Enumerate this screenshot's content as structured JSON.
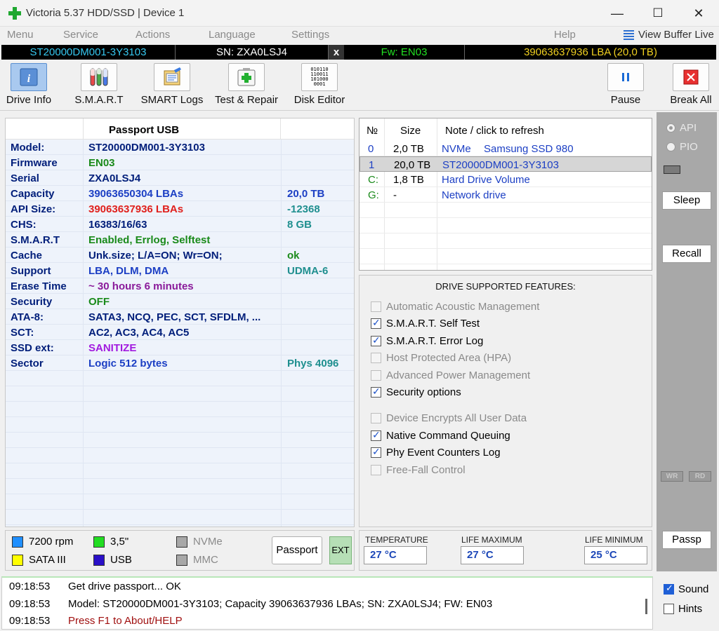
{
  "window": {
    "title": "Victoria 5.37 HDD/SSD | Device 1",
    "minimize": "—",
    "maximize": "☐",
    "close": "✕"
  },
  "menu": {
    "items": [
      "Menu",
      "Service",
      "Actions",
      "Language",
      "Settings",
      "Help"
    ],
    "view_buffer": "View Buffer Live"
  },
  "device_bar": {
    "model": "ST20000DM001-3Y3103",
    "serial": "SN: ZXA0LSJ4",
    "close": "x",
    "firmware": "Fw: EN03",
    "lba": "39063637936 LBA (20,0 TB)"
  },
  "toolbar": {
    "drive_info": "Drive Info",
    "smart": "S.M.A.R.T",
    "smart_logs": "SMART Logs",
    "test_repair": "Test & Repair",
    "disk_editor": "Disk Editor",
    "pause": "Pause",
    "break_all": "Break All",
    "disk_editor_glyph": [
      "010110",
      "110011",
      "101000",
      "0001"
    ]
  },
  "passport": {
    "header": "Passport USB",
    "rows": [
      {
        "key": "Model:",
        "value": "ST20000DM001-3Y3103",
        "extra": "",
        "color": "#001e7a",
        "extra_color": ""
      },
      {
        "key": "Firmware",
        "value": "EN03",
        "extra": "",
        "color": "#1a8a1a",
        "extra_color": ""
      },
      {
        "key": "Serial",
        "value": "ZXA0LSJ4",
        "extra": "",
        "color": "#001e7a",
        "extra_color": ""
      },
      {
        "key": "Capacity",
        "value": "39063650304 LBAs",
        "extra": "20,0 TB",
        "color": "#1c3fc4",
        "extra_color": "#1c3fc4"
      },
      {
        "key": "API Size:",
        "value": "39063637936 LBAs",
        "extra": "-12368",
        "color": "#e0201c",
        "extra_color": "#1f8f8f"
      },
      {
        "key": "CHS:",
        "value": "16383/16/63",
        "extra": "8 GB",
        "color": "#001e7a",
        "extra_color": "#1f8f8f"
      },
      {
        "key": "S.M.A.R.T",
        "value": "Enabled, Errlog, Selftest",
        "extra": "",
        "color": "#1a8a1a",
        "extra_color": ""
      },
      {
        "key": "Cache",
        "value": "Unk.size; L/A=ON; Wr=ON;",
        "extra": "ok",
        "color": "#001e7a",
        "extra_color": "#1a8a1a"
      },
      {
        "key": "Support",
        "value": "LBA, DLM, DMA",
        "extra": "UDMA-6",
        "color": "#1c3fc4",
        "extra_color": "#1f8f8f"
      },
      {
        "key": "Erase Time",
        "value": "~ 30 hours 6 minutes",
        "extra": "",
        "color": "#8a1a9a",
        "extra_color": ""
      },
      {
        "key": "Security",
        "value": "OFF",
        "extra": "",
        "color": "#1a8a1a",
        "extra_color": ""
      },
      {
        "key": "ATA-8:",
        "value": "SATA3, NCQ, PEC, SCT, SFDLM, ...",
        "extra": "",
        "color": "#001e7a",
        "extra_color": ""
      },
      {
        "key": "SCT:",
        "value": "AC2, AC3, AC4, AC5",
        "extra": "",
        "color": "#001e7a",
        "extra_color": ""
      },
      {
        "key": "SSD ext:",
        "value": "SANITIZE",
        "extra": "",
        "color": "#a21adf",
        "extra_color": ""
      },
      {
        "key": "Sector",
        "value": "Logic 512 bytes",
        "extra": "Phys 4096",
        "color": "#1c3fc4",
        "extra_color": "#1f8f8f"
      }
    ]
  },
  "device_list": {
    "headers": [
      "№",
      "Size",
      "Note / click to refresh"
    ],
    "rows": [
      {
        "no": "0",
        "size": "2,0 TB",
        "note": "NVMe",
        "note2": "Samsung SSD 980",
        "no_color": "#1c3fc4",
        "note_color": "#1c3fc4"
      },
      {
        "no": "1",
        "size": "20,0 TB",
        "note": "ST20000DM001-3Y3103",
        "note2": "",
        "no_color": "#1c3fc4",
        "note_color": "#1c3fc4"
      },
      {
        "no": "C:",
        "size": "1,8 TB",
        "note": "Hard Drive Volume",
        "note2": "",
        "no_color": "#1a8a1a",
        "note_color": "#1c3fc4"
      },
      {
        "no": "G:",
        "size": "-",
        "note": "Network drive",
        "note2": "",
        "no_color": "#1a8a1a",
        "note_color": "#1c3fc4"
      }
    ]
  },
  "features": {
    "title": "DRIVE SUPPORTED FEATURES:",
    "items": [
      {
        "label": "Automatic Acoustic Management",
        "checked": false,
        "enabled": false
      },
      {
        "label": "S.M.A.R.T. Self Test",
        "checked": true,
        "enabled": true
      },
      {
        "label": "S.M.A.R.T. Error Log",
        "checked": true,
        "enabled": true
      },
      {
        "label": "Host Protected Area (HPA)",
        "checked": false,
        "enabled": false
      },
      {
        "label": "Advanced Power Management",
        "checked": false,
        "enabled": false
      },
      {
        "label": "Security options",
        "checked": true,
        "enabled": true
      },
      {
        "label": "Device Encrypts All User Data",
        "checked": false,
        "enabled": false
      },
      {
        "label": "Native Command Queuing",
        "checked": true,
        "enabled": true
      },
      {
        "label": "Phy Event Counters Log",
        "checked": true,
        "enabled": true
      },
      {
        "label": "Free-Fall Control",
        "checked": false,
        "enabled": false
      }
    ]
  },
  "sidebar": {
    "api": "API",
    "pio": "PIO",
    "sleep": "Sleep",
    "recall": "Recall",
    "wr": "WR",
    "rd": "RD",
    "passp": "Passp"
  },
  "status": {
    "rpm": "7200 rpm",
    "form": "3,5\"",
    "nvme": "NVMe",
    "sata": "SATA III",
    "usb": "USB",
    "mmc": "MMC",
    "passport_btn": "Passport",
    "ext_btn": "EXT",
    "colors": {
      "rpm": "#1f8fff",
      "form": "#22dd22",
      "nvme": "#a8a8a8",
      "sata": "#ffff00",
      "usb": "#2a10c8",
      "mmc": "#a8a8a8"
    }
  },
  "temps": {
    "temperature_label": "TEMPERATURE",
    "temperature": "27 °C",
    "life_max_label": "LIFE MAXIMUM",
    "life_max": "27 °C",
    "life_min_label": "LIFE MINIMUM",
    "life_min": "25 °C"
  },
  "log": [
    {
      "time": "09:18:53",
      "msg": "Get drive passport... OK",
      "color": "#000000"
    },
    {
      "time": "09:18:53",
      "msg": "Model: ST20000DM001-3Y3103; Capacity 39063637936 LBAs; SN: ZXA0LSJ4; FW: EN03",
      "color": "#000000"
    },
    {
      "time": "09:18:53",
      "msg": "Press F1 to About/HELP",
      "color": "#a01010"
    }
  ],
  "log_side": {
    "sound": "Sound",
    "hints": "Hints"
  }
}
